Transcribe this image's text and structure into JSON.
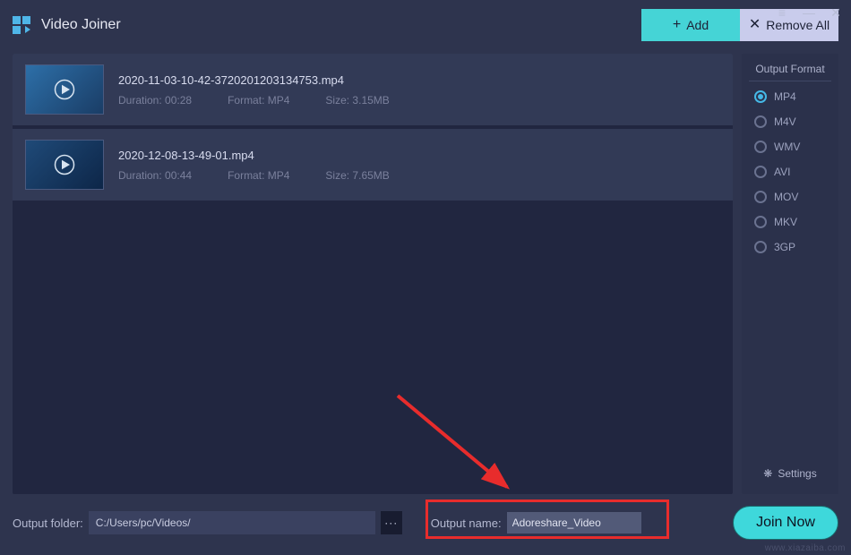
{
  "app": {
    "title": "Video Joiner"
  },
  "toolbar": {
    "add_label": "Add",
    "remove_label": "Remove All"
  },
  "files": [
    {
      "name": "2020-11-03-10-42-3720201203134753.mp4",
      "duration_label": "Duration: 00:28",
      "format_label": "Format: MP4",
      "size_label": "Size: 3.15MB"
    },
    {
      "name": "2020-12-08-13-49-01.mp4",
      "duration_label": "Duration: 00:44",
      "format_label": "Format: MP4",
      "size_label": "Size: 7.65MB"
    }
  ],
  "sidebar": {
    "title": "Output Format",
    "formats": [
      "MP4",
      "M4V",
      "WMV",
      "AVI",
      "MOV",
      "MKV",
      "3GP"
    ],
    "selected_index": 0,
    "settings_label": "Settings"
  },
  "output": {
    "folder_label": "Output folder:",
    "folder_value": "C:/Users/pc/Videos/",
    "name_label": "Output name:",
    "name_value": "Adoreshare_Video"
  },
  "join_label": "Join Now",
  "watermark": "www.xiazaiba.com"
}
